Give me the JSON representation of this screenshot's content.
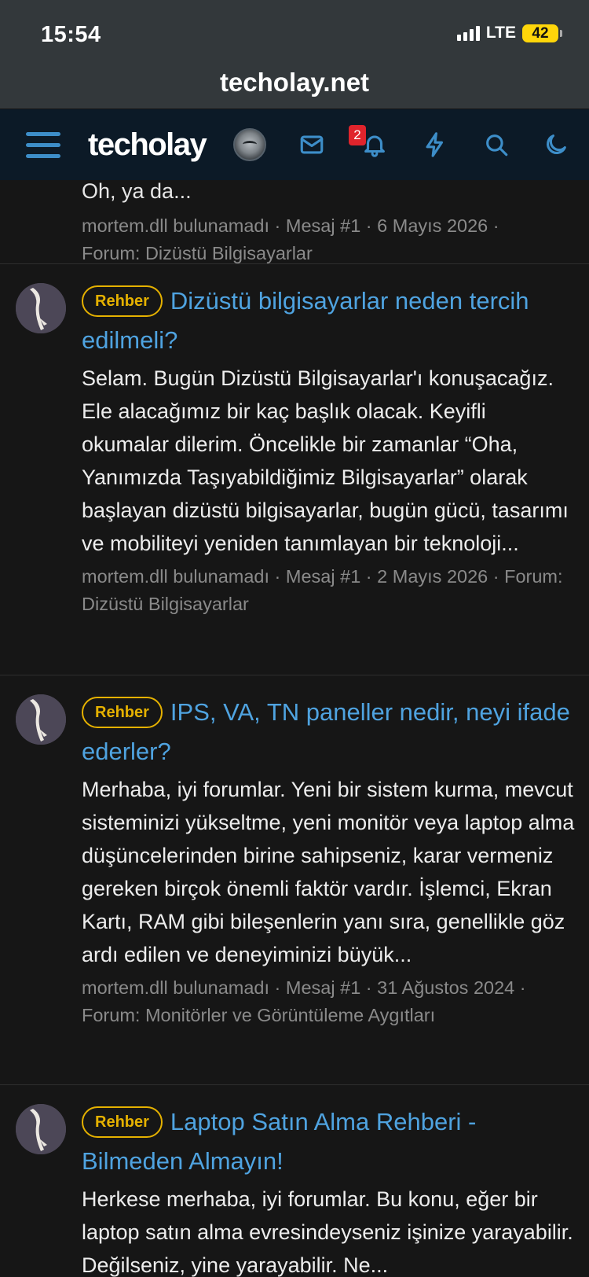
{
  "status": {
    "time": "15:54",
    "network": "LTE",
    "battery": "42"
  },
  "browser": {
    "url": "techolay.net"
  },
  "nav": {
    "logo": "techolay",
    "alert_count": "2",
    "icons": [
      "menu-icon",
      "mail-icon",
      "bell-icon",
      "bolt-icon",
      "search-icon",
      "moon-icon"
    ],
    "accent_color": "#3d8ec9"
  },
  "partial_result": {
    "text_fragment": "Oh, ya da...",
    "meta_line1": "mortem.dll bulunamadı · Mesaj #1 · 6 Mayıs 2026 ·",
    "meta_line2": "Forum: Dizüstü Bilgisayarlar"
  },
  "results": [
    {
      "prefix": "Rehber",
      "title": "Dizüstü bilgisayarlar neden tercih edilmeli?",
      "snippet": "Selam. Bugün Dizüstü Bilgisayarlar'ı konuşacağız. Ele alacağımız bir kaç başlık olacak. Keyifli okumalar dilerim. Öncelikle bir zamanlar “Oha, Yanımızda Taşıyabildiğimiz Bilgisayarlar” olarak başlayan dizüstü bilgisayarlar, bugün gücü, tasarımı ve mobiliteyi yeniden tanımlayan bir teknoloji...",
      "meta": "mortem.dll bulunamadı · Mesaj #1 · 2 Mayıs 2026 · Forum: Dizüstü Bilgisayarlar"
    },
    {
      "prefix": "Rehber",
      "title": "IPS, VA, TN paneller nedir, neyi ifade ederler?",
      "snippet": "Merhaba, iyi forumlar. Yeni bir sistem kurma, mevcut sisteminizi yükseltme, yeni monitör veya laptop alma düşüncelerinden birine sahipseniz, karar vermeniz gereken birçok önemli faktör vardır. İşlemci, Ekran Kartı, RAM gibi bileşenlerin yanı sıra, genellikle göz ardı edilen ve deneyiminizi büyük...",
      "meta": "mortem.dll bulunamadı · Mesaj #1 · 31 Ağustos 2024 · Forum: Monitörler ve Görüntüleme Aygıtları"
    },
    {
      "prefix": "Rehber",
      "title": "Laptop Satın Alma Rehberi - Bilmeden Almayın!",
      "snippet": "Herkese merhaba, iyi forumlar. Bu konu, eğer bir laptop satın alma evresindeyseniz işinize yarayabilir. Değilseniz, yine yarayabilir. Ne...",
      "meta": ""
    }
  ]
}
